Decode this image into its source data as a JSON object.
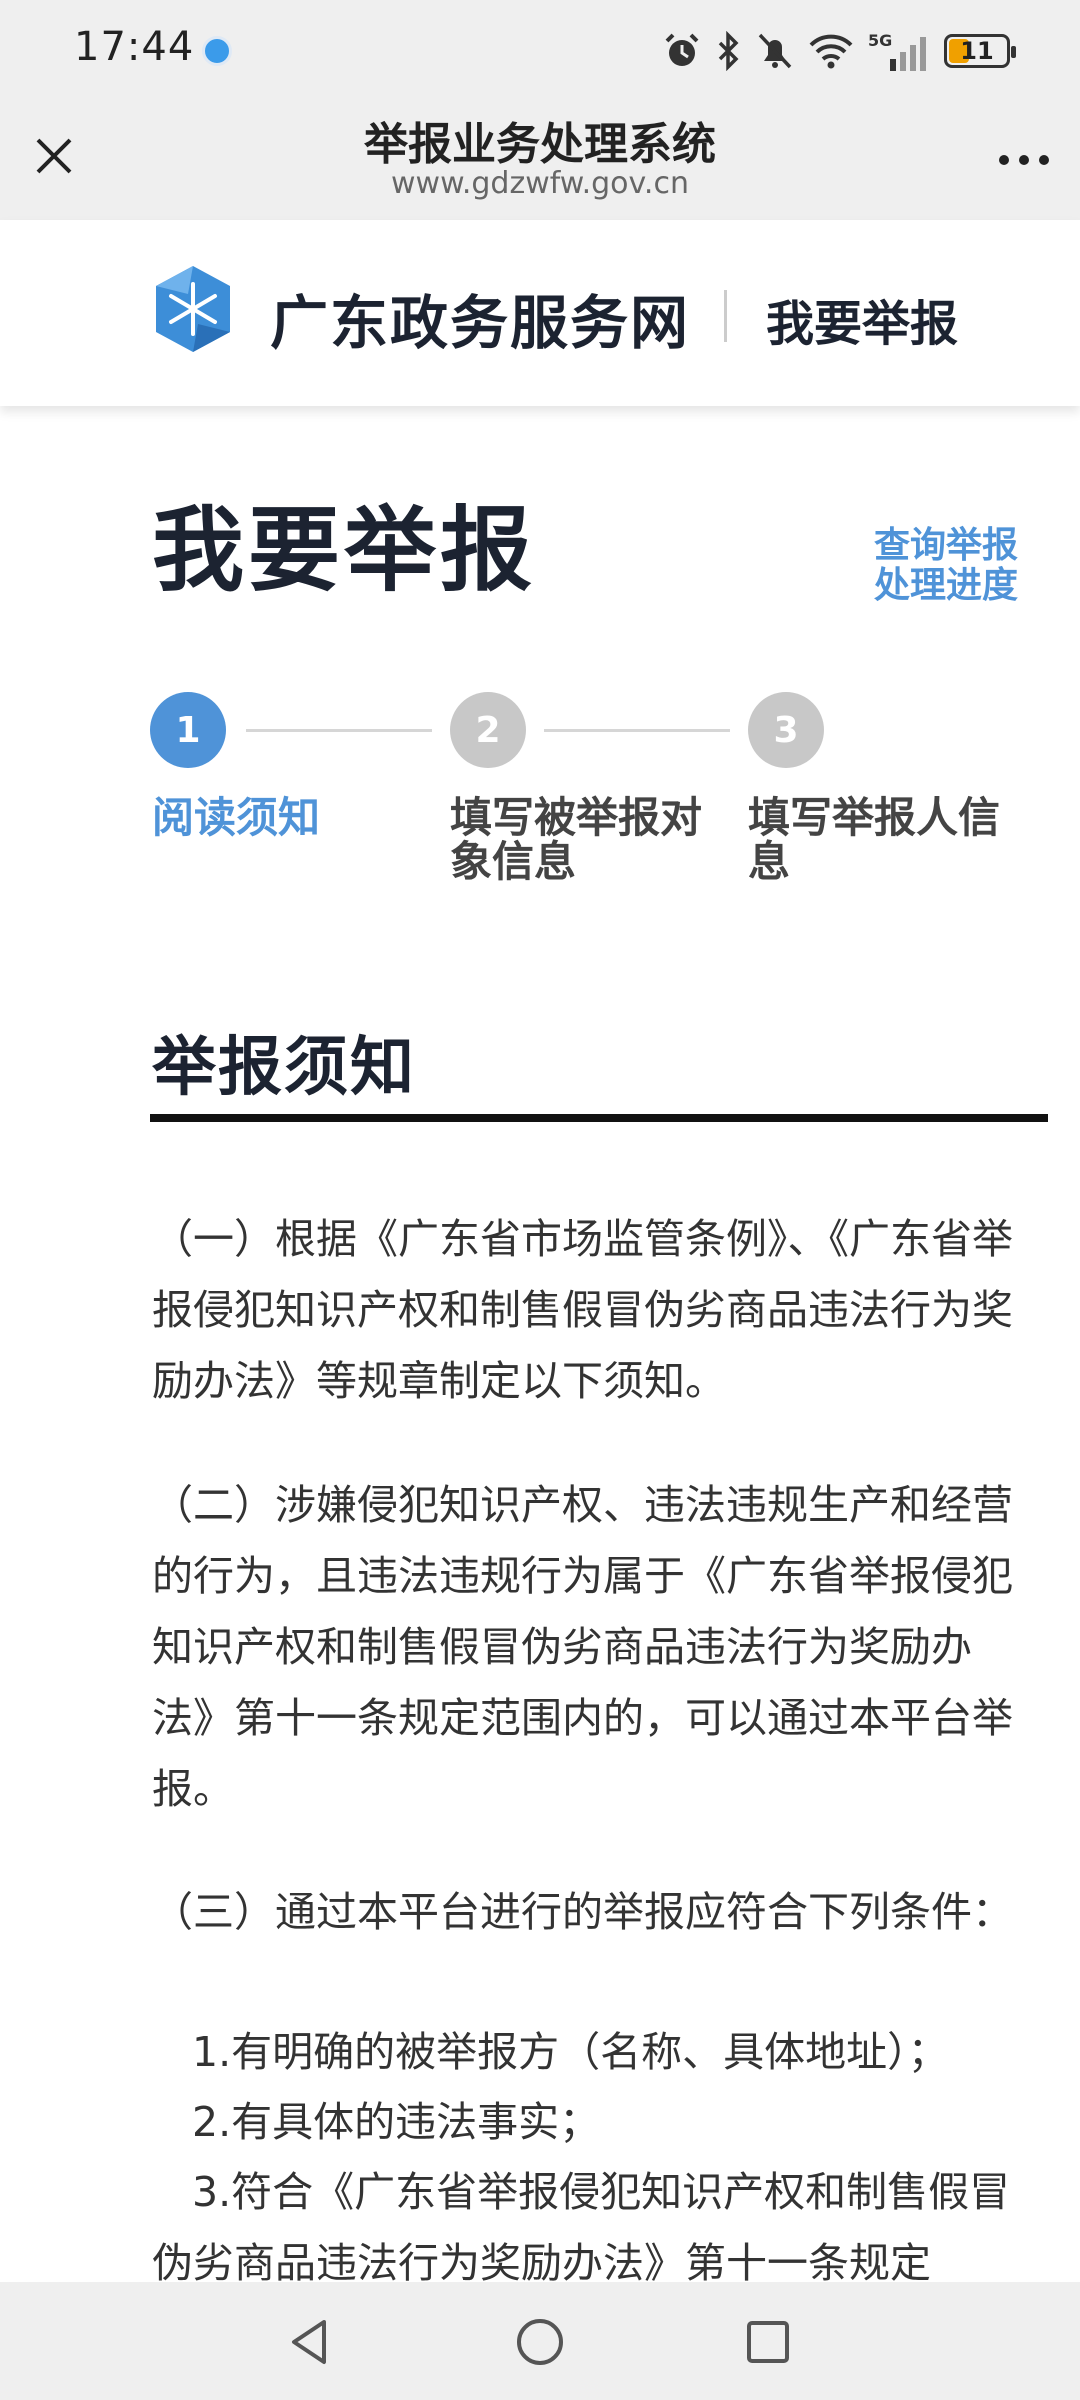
{
  "status_bar": {
    "time": "17:44",
    "signal_label": "5G",
    "battery_level": "11",
    "icons": [
      "alarm-icon",
      "bluetooth-icon",
      "bell-muted-icon",
      "wifi-icon",
      "signal-icon",
      "battery-icon"
    ]
  },
  "browser": {
    "title": "举报业务处理系统",
    "url": "www.gdzwfw.gov.cn"
  },
  "site_header": {
    "site_name": "广东政务服务网",
    "section_link": "我要举报"
  },
  "page": {
    "title": "我要举报",
    "query_link": "查询举报处理进度"
  },
  "steps": [
    {
      "number": "1",
      "label": "阅读须知",
      "active": true
    },
    {
      "number": "2",
      "label": "填写被举报对象信息",
      "active": false
    },
    {
      "number": "3",
      "label": "填写举报人信息",
      "active": false
    }
  ],
  "notice": {
    "title": "举报须知",
    "paragraphs": [
      "（一）根据《广东省市场监管条例》、《广东省举报侵犯知识产权和制售假冒伪劣商品违法行为奖励办法》等规章制定以下须知。",
      "（二）涉嫌侵犯知识产权、违法违规生产和经营的行为，且违法违规行为属于《广东省举报侵犯知识产权和制售假冒伪劣商品违法行为奖励办法》第十一条规定范围内的，可以通过本平台举报。",
      "（三）通过本平台进行的举报应符合下列条件：",
      "1.有明确的被举报方（名称、具体地址）；",
      "2.有具体的违法事实；",
      "3.符合《广东省举报侵犯知识产权和制售假冒伪劣商品违法行为奖励办法》第十一条规定"
    ]
  },
  "colors": {
    "accent": "#4f93d8",
    "active_step": "#4f93d8",
    "inactive_step": "#c8c8c8",
    "heading": "#1c2331"
  }
}
